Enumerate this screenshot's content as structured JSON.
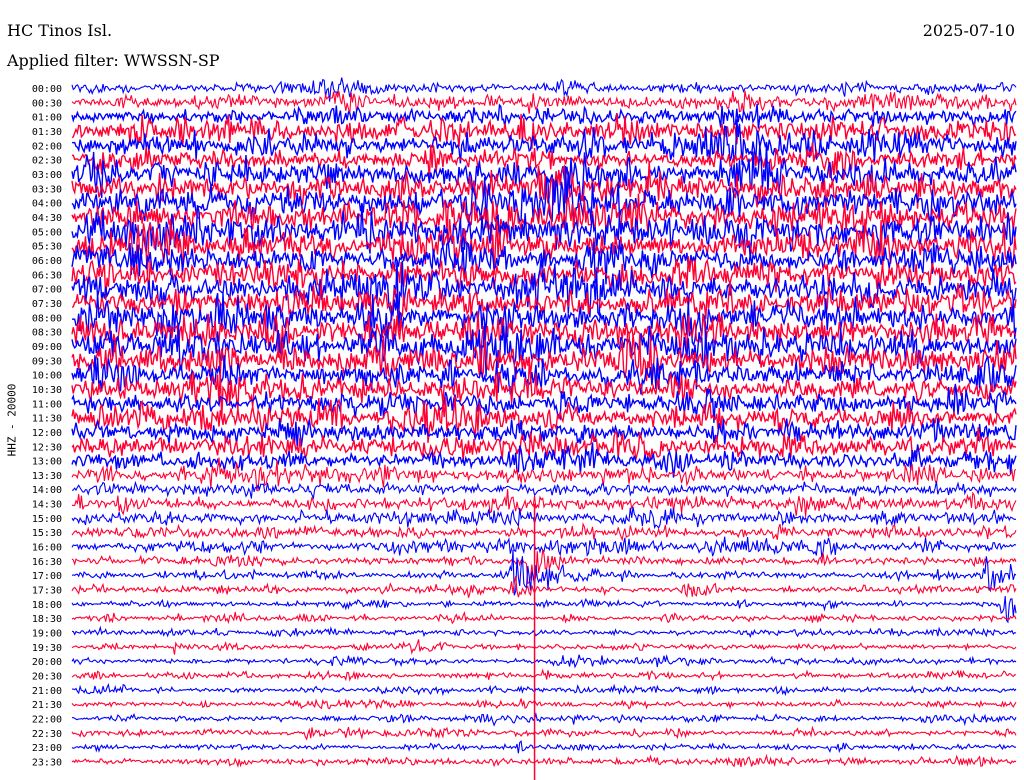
{
  "header": {
    "station": "HC Tinos Isl.",
    "filter": "Applied filter: WWSSN-SP",
    "date": "2025-07-10"
  },
  "channel_label": "HHZ - 20000",
  "colors": {
    "trace_a": "#0000ff",
    "trace_b": "#ff0033",
    "marker": "#ff0033",
    "background": "#ffffff",
    "text": "#000000"
  },
  "chart_data": {
    "type": "line",
    "title": "HC Tinos Isl.",
    "subtitle": "Applied filter: WWSSN-SP",
    "ylabel": "HHZ - 20000",
    "row_labels": [
      "00:00",
      "00:30",
      "01:00",
      "01:30",
      "02:00",
      "02:30",
      "03:00",
      "03:30",
      "04:00",
      "04:30",
      "05:00",
      "05:30",
      "06:00",
      "06:30",
      "07:00",
      "07:30",
      "08:00",
      "08:30",
      "09:00",
      "09:30",
      "10:00",
      "10:30",
      "11:00",
      "11:30",
      "12:00",
      "12:30",
      "13:00",
      "13:30",
      "14:00",
      "14:30",
      "15:00",
      "15:30",
      "16:00",
      "16:30",
      "17:00",
      "17:30",
      "18:00",
      "18:30",
      "19:00",
      "19:30",
      "20:00",
      "20:30",
      "21:00",
      "21:30",
      "22:00",
      "22:30",
      "23:00",
      "23:30"
    ],
    "row_minutes": 30,
    "row_colors": [
      "trace_a",
      "trace_b"
    ],
    "noise_level": [
      0.35,
      0.45,
      0.55,
      0.7,
      0.7,
      0.65,
      0.95,
      1.0,
      1.0,
      1.0,
      1.0,
      1.0,
      1.0,
      1.0,
      1.0,
      1.0,
      1.0,
      1.0,
      1.0,
      0.95,
      0.85,
      0.85,
      0.8,
      0.75,
      0.7,
      0.75,
      0.6,
      0.5,
      0.4,
      0.45,
      0.45,
      0.4,
      0.35,
      0.3,
      0.25,
      0.25,
      0.2,
      0.2,
      0.2,
      0.2,
      0.2,
      0.2,
      0.2,
      0.2,
      0.2,
      0.2,
      0.2,
      0.2
    ],
    "events": [
      {
        "row": "16:30",
        "minute": 14.5,
        "amplitude": 2.2,
        "duration_min": 1.2
      },
      {
        "row": "17:00",
        "minute": 14.0,
        "amplitude": 2.4,
        "duration_min": 1.8
      },
      {
        "row": "17:30",
        "minute": 14.0,
        "amplitude": 1.4,
        "duration_min": 0.8
      },
      {
        "row": "17:30",
        "minute": 19.5,
        "amplitude": 1.0,
        "duration_min": 0.9
      },
      {
        "row": "17:00",
        "minute": 29.0,
        "amplitude": 2.0,
        "duration_min": 1.2
      },
      {
        "row": "18:00",
        "minute": 29.6,
        "amplitude": 2.0,
        "duration_min": 1.0
      },
      {
        "row": "18:00",
        "minute": 24.0,
        "amplitude": 1.0,
        "duration_min": 0.6
      },
      {
        "row": "19:30",
        "minute": 3.2,
        "amplitude": 0.7,
        "duration_min": 0.6
      },
      {
        "row": "20:30",
        "minute": 15.0,
        "amplitude": 0.5,
        "duration_min": 0.4
      },
      {
        "row": "22:30",
        "minute": 7.5,
        "amplitude": 0.8,
        "duration_min": 0.7
      },
      {
        "row": "23:00",
        "minute": 14.2,
        "amplitude": 0.6,
        "duration_min": 0.5
      }
    ],
    "marker_minute": 14.7
  }
}
